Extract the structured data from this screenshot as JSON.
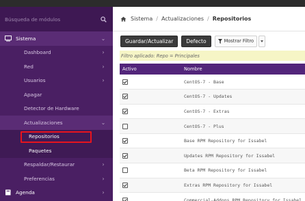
{
  "sidebar": {
    "search_placeholder": "Búsqueda de módulos",
    "items": [
      {
        "label": "Sistema",
        "level": "parent",
        "chevron": "⌄"
      },
      {
        "label": "Dashboard",
        "level": "sub",
        "chevron": "›"
      },
      {
        "label": "Red",
        "level": "sub",
        "chevron": "›"
      },
      {
        "label": "Usuarios",
        "level": "sub",
        "chevron": "›"
      },
      {
        "label": "Apagar",
        "level": "sub",
        "chevron": ""
      },
      {
        "label": "Detector de Hardware",
        "level": "sub",
        "chevron": ""
      },
      {
        "label": "Actualizaciones",
        "level": "sub",
        "chevron": "⌄"
      },
      {
        "label": "Repositorios",
        "level": "subsub",
        "chevron": ""
      },
      {
        "label": "Paquetes",
        "level": "subsub",
        "chevron": ""
      },
      {
        "label": "Respaldar/Restaurar",
        "level": "sub",
        "chevron": "›"
      },
      {
        "label": "Preferencias",
        "level": "sub",
        "chevron": "›"
      },
      {
        "label": "Agenda",
        "level": "parent",
        "chevron": "›"
      }
    ]
  },
  "breadcrumb": {
    "home": "Sistema",
    "middle": "Actualizaciones",
    "current": "Repositorios",
    "separator": "/"
  },
  "toolbar": {
    "save_label": "Guardar/Actualizar",
    "default_label": "Defecto",
    "filter_label": "Mostrar Filtro"
  },
  "filter_note": "Filtro aplicado: Repo = Principales",
  "table": {
    "columns": [
      "Activo",
      "Nombre"
    ],
    "rows": [
      {
        "active": true,
        "name": "CentOS-7 - Base"
      },
      {
        "active": true,
        "name": "CentOS-7 - Updates"
      },
      {
        "active": true,
        "name": "CentOS-7 - Extras"
      },
      {
        "active": false,
        "name": "CentOS-7 - Plus"
      },
      {
        "active": true,
        "name": "Base RPM Repository for Issabel"
      },
      {
        "active": true,
        "name": "Updates RPM Repository for Issabel"
      },
      {
        "active": false,
        "name": "Beta RPM Repository for Issabel"
      },
      {
        "active": true,
        "name": "Extras RPM Repository for Issabel"
      },
      {
        "active": true,
        "name": "Commercial-Addons RPM Repository for Issabel"
      }
    ]
  },
  "colors": {
    "sidebar_bg": "#4a1f63",
    "table_header": "#52257a",
    "highlight": "#e8141d"
  }
}
